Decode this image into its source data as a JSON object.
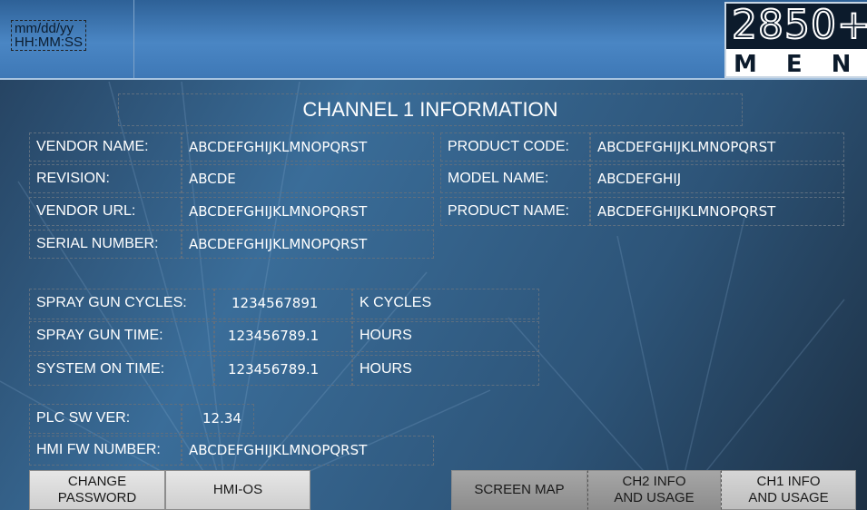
{
  "header": {
    "date_format": "mm/dd/yy",
    "time_format": "HH:MM:SS",
    "logo_number": "2850+",
    "logo_menu": "MENU"
  },
  "title": "CHANNEL 1 INFORMATION",
  "info": {
    "vendor_name_label": "VENDOR NAME:",
    "vendor_name_value": "ABCDEFGHIJKLMNOPQRST",
    "revision_label": "REVISION:",
    "revision_value": "ABCDE",
    "vendor_url_label": "VENDOR URL:",
    "vendor_url_value": "ABCDEFGHIJKLMNOPQRST",
    "serial_number_label": "SERIAL NUMBER:",
    "serial_number_value": "ABCDEFGHIJKLMNOPQRST",
    "product_code_label": "PRODUCT CODE:",
    "product_code_value": "ABCDEFGHIJKLMNOPQRST",
    "model_name_label": "MODEL NAME:",
    "model_name_value": "ABCDEFGHIJ",
    "product_name_label": "PRODUCT NAME:",
    "product_name_value": "ABCDEFGHIJKLMNOPQRST"
  },
  "usage": {
    "gun_cycles_label": "SPRAY GUN CYCLES:",
    "gun_cycles_value": "1234567891",
    "gun_cycles_unit": "K CYCLES",
    "gun_time_label": "SPRAY GUN TIME:",
    "gun_time_value": "123456789.1",
    "gun_time_unit": "HOURS",
    "system_time_label": "SYSTEM ON TIME:",
    "system_time_value": "123456789.1",
    "system_time_unit": "HOURS"
  },
  "versions": {
    "plc_label": "PLC SW VER:",
    "plc_value": "12.34",
    "hmi_label": "HMI FW NUMBER:",
    "hmi_value": "ABCDEFGHIJKLMNOPQRST"
  },
  "buttons": {
    "change_password": "CHANGE\nPASSWORD",
    "hmi_os": "HMI-OS",
    "screen_map": "SCREEN MAP",
    "ch2_info": "CH2 INFO\nAND USAGE",
    "ch1_info": "CH1 INFO\nAND USAGE"
  },
  "colors": {
    "header_blue": "#4a86c4",
    "background_blue": "#3a6d99",
    "button_light": "#dcdcdc",
    "button_dark": "#9a9a9a"
  }
}
